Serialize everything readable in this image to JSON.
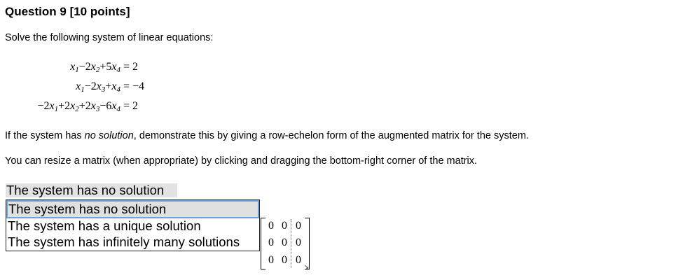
{
  "question": {
    "title": "Question 9 [10 points]",
    "prompt": "Solve the following system of linear equations:"
  },
  "equations": [
    {
      "lhs": [
        {
          "t": "v",
          "s": "x",
          "n": "1"
        },
        {
          "t": "o",
          "s": "−2"
        },
        {
          "t": "v",
          "s": "x",
          "n": "2"
        },
        {
          "t": "o",
          "s": "+5"
        },
        {
          "t": "v",
          "s": "x",
          "n": "4"
        }
      ],
      "rhs": "= 2"
    },
    {
      "lhs": [
        {
          "t": "v",
          "s": "x",
          "n": "1"
        },
        {
          "t": "o",
          "s": "−2"
        },
        {
          "t": "v",
          "s": "x",
          "n": "3"
        },
        {
          "t": "o",
          "s": "+"
        },
        {
          "t": "v",
          "s": "x",
          "n": "4"
        }
      ],
      "rhs": "= −4"
    },
    {
      "lhs": [
        {
          "t": "o",
          "s": "−2"
        },
        {
          "t": "v",
          "s": "x",
          "n": "1"
        },
        {
          "t": "o",
          "s": "+2"
        },
        {
          "t": "v",
          "s": "x",
          "n": "2"
        },
        {
          "t": "o",
          "s": "+2"
        },
        {
          "t": "v",
          "s": "x",
          "n": "3"
        },
        {
          "t": "o",
          "s": "−6"
        },
        {
          "t": "v",
          "s": "x",
          "n": "4"
        }
      ],
      "rhs": "= 2"
    }
  ],
  "instructions": {
    "no_solution_prefix": "If the system has ",
    "no_solution_em": "no solution",
    "no_solution_suffix": ", demonstrate this by giving a row-echelon form of the augmented matrix for the system.",
    "resize_hint": "You can resize a matrix (when appropriate) by clicking and dragging the bottom-right corner of the matrix."
  },
  "answer_select": {
    "selected": "The system has no solution",
    "options": [
      "The system has no solution",
      "The system has a unique solution",
      "The system has infinitely many solutions"
    ]
  },
  "matrix": {
    "cells": [
      [
        "0",
        "0",
        "0"
      ],
      [
        "0",
        "0",
        "0"
      ],
      [
        "0",
        "0",
        "0"
      ]
    ],
    "resize_icon": "resize-grip-icon"
  }
}
